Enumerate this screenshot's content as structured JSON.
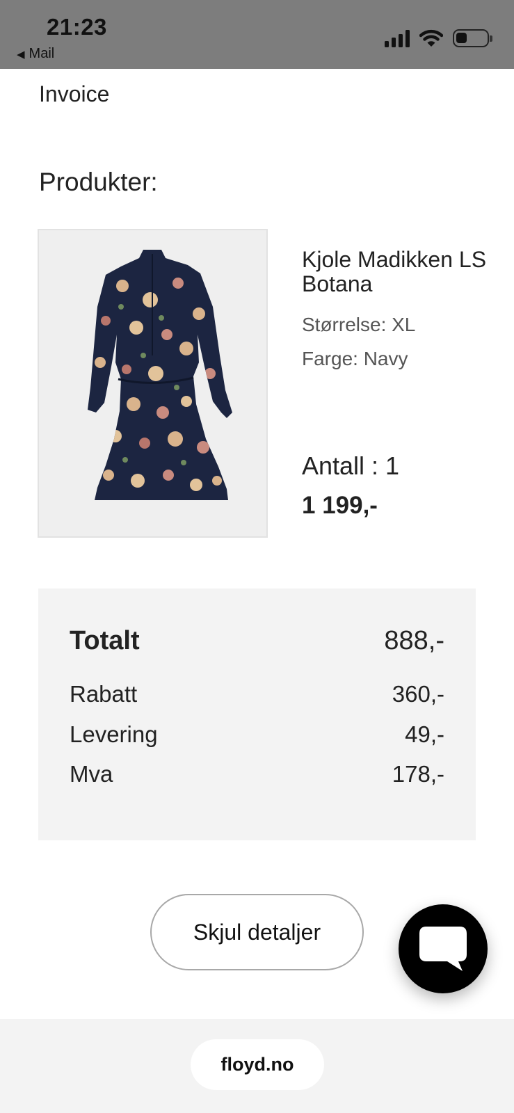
{
  "status_bar": {
    "time": "21:23",
    "back_label": "Mail",
    "icons": [
      "signal-icon",
      "wifi-icon",
      "battery-icon"
    ]
  },
  "invoice": {
    "label": "Invoice"
  },
  "products": {
    "heading": "Produkter:",
    "items": [
      {
        "name": "Kjole Madikken LS Botana",
        "size": "Størrelse: XL",
        "color": "Farge: Navy",
        "quantity": "Antall : 1",
        "price": "1 199,-",
        "image": "floral-navy-dress"
      }
    ]
  },
  "summary": {
    "total_label": "Totalt",
    "total_value": "888,-",
    "rows": [
      {
        "label": "Rabatt",
        "value": "360,-"
      },
      {
        "label": "Levering",
        "value": "49,-"
      },
      {
        "label": "Mva",
        "value": "178,-"
      }
    ]
  },
  "actions": {
    "hide_details_label": "Skjul detaljer",
    "chat_icon": "chat-bubble-icon"
  },
  "browser": {
    "url": "floyd.no"
  },
  "colors": {
    "status_bar_bg": "#7d7d7d",
    "summary_bg": "#f3f3f3",
    "dress_navy": "#1c2541",
    "chat_button": "#000000"
  }
}
